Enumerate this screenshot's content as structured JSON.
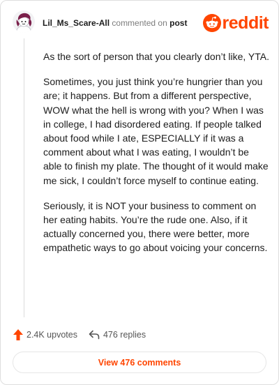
{
  "comment": {
    "username": "Lil_Ms_Scare-All",
    "commented_on_text": "commented on",
    "post_link": "post",
    "paragraphs": [
      "As the sort of person that you clearly don’t like, YTA.",
      "Sometimes, you just think you’re hungrier than you are; it happens. But from a different perspective, WOW what the hell is wrong with you? When I was in college, I had disordered eating. If people talked about food while I ate, ESPECIALLY if it was a comment about what I was eating, I wouldn’t be able to finish my plate. The thought of it would make me sick, I couldn’t force myself to continue eating.",
      "Seriously, it is NOT your business to comment on her eating habits. You’re the rude one. Also, if it actually concerned you, there were better, more empathetic ways to go about voicing your concerns."
    ]
  },
  "brand": {
    "wordmark": "reddit",
    "color": "#ff4500"
  },
  "actions": {
    "upvotes": "2.4K upvotes",
    "replies": "476 replies"
  },
  "view_comments_label": "View 476 comments",
  "icons": {
    "avatar": "avatar-icon",
    "logo": "reddit-snoo-icon",
    "upvote": "upvote-arrow-icon",
    "reply": "reply-arrow-icon"
  }
}
